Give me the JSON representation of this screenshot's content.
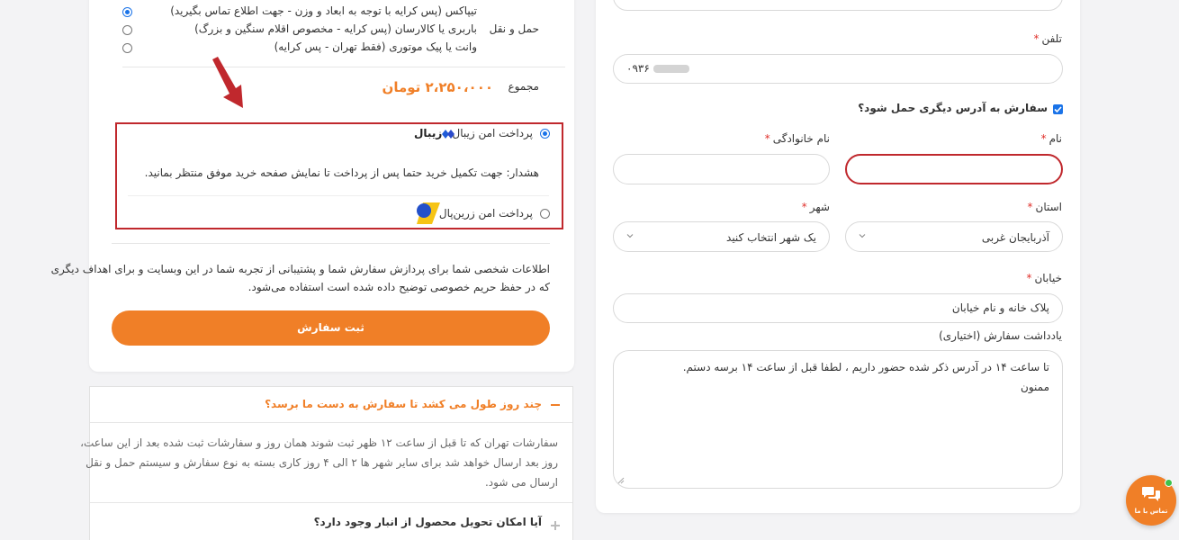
{
  "shipping": {
    "label": "حمل و نقل",
    "options": [
      {
        "label": "تیپاکس (پس کرایه با توجه به ابعاد و وزن - جهت اطلاع تماس بگیرید)",
        "selected": true
      },
      {
        "label": "باربری یا کالارسان (پس کرایه - مخصوص اقلام سنگین و بزرگ)",
        "selected": false
      },
      {
        "label": "وانت یا پیک موتوری (فقط تهران - پس کرایه)",
        "selected": false
      }
    ]
  },
  "total": {
    "label": "مجموع",
    "value": "۲،۲۵۰،۰۰۰ تومان"
  },
  "payment": {
    "zibal": {
      "label": "پرداخت امن زیبال",
      "logo_text": "زیبال",
      "selected": true
    },
    "warning": "هشدار: جهت تکمیل خرید حتما پس از پرداخت تا نمایش صفحه خرید موفق منتظر بمانید.",
    "zarinpal": {
      "label": "پرداخت امن زرین‌پال",
      "selected": false
    }
  },
  "privacy_text_line1": "اطلاعات شخصی شما برای پردازش سفارش شما و پشتیبانی از تجربه شما در این وبسایت و برای اهداف دیگری",
  "privacy_text_line2": "که در حفظ حریم خصوصی توضیح داده شده است استفاده می‌شود.",
  "order_button": "ثبت سفارش",
  "faq": [
    {
      "question": "چند روز طول می کشد تا سفارش به دست ما برسد؟",
      "expanded": true,
      "answer_lines": [
        "سفارشات تهران که تا قبل از ساعت ۱۲ ظهر ثبت شوند همان روز و سفارشات ثبت شده بعد از این ساعت،",
        "روز بعد ارسال خواهد شد برای سایر شهر ها ۲ الی ۴ روز کاری بسته به نوع سفارش و سیستم حمل و نقل",
        "ارسال می شود."
      ]
    },
    {
      "question": "آیا امکان تحویل محصول از انبار وجود دارد؟",
      "expanded": false
    }
  ],
  "form": {
    "phone_label": "تلفن",
    "phone_value": "۰۹۳۶",
    "ship_other_label": "سفارش به آدرس دیگری حمل شود؟",
    "ship_other_checked": true,
    "first_name_label": "نام",
    "first_name_value": "",
    "last_name_label": "نام خانوادگی",
    "last_name_value": "",
    "province_label": "استان",
    "province_value": "آذربایجان غربی",
    "city_label": "شهر",
    "city_value": "یک شهر انتخاب کنید",
    "street_label": "خیابان",
    "street_placeholder": "پلاک خانه و نام خیابان",
    "notes_label": "یادداشت سفارش (اختیاری)",
    "notes_line1": "تا ساعت ۱۴ در آدرس ذکر شده حضور داریم ، لطفا قبل از ساعت ۱۴ برسه دستم.",
    "notes_line2": "ممنون",
    "required_mark": "*"
  },
  "chat": {
    "label": "تماس با ما"
  },
  "colors": {
    "accent": "#f07f27",
    "highlight_border": "#c0282d",
    "link_blue": "#1a73e8"
  }
}
